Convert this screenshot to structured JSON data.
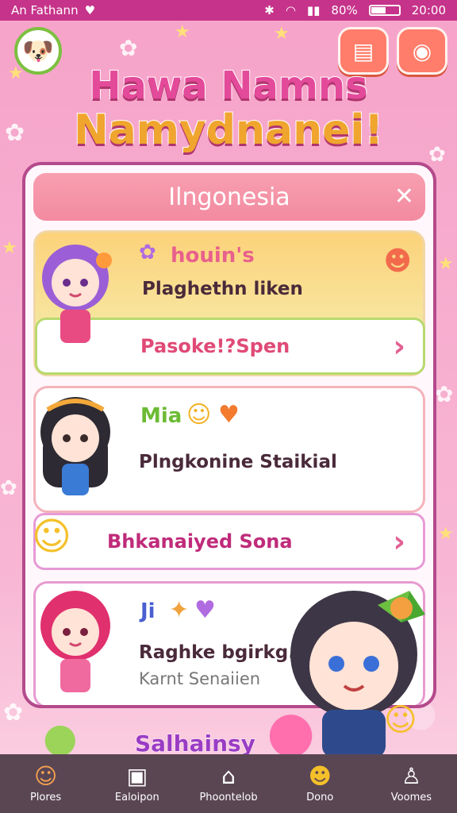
{
  "status_bar": {
    "left_text": "An Fathann",
    "heart_icon": "heart-icon",
    "battery_text": "80%",
    "time": "20:00"
  },
  "header": {
    "title_line1": "Hawa Namns",
    "title_line2": "Namydnanei!"
  },
  "panel": {
    "title": "Ilngonesia",
    "close_symbol": "✕"
  },
  "cards": [
    {
      "name": "houin's",
      "line": "Plaghethn liken",
      "sub_label": "Pasoke!?Spen"
    },
    {
      "name": "Mia",
      "line": "Plngkonine Staikial",
      "sub_label": "Bhkanaiyed Sona"
    },
    {
      "name": "Ji",
      "line": "Raghke bgirkg.",
      "line2": "Karnt Senaiien"
    }
  ],
  "bottom_label": "Salhainsy",
  "nav": [
    {
      "label": "Plores",
      "icon": "character-icon"
    },
    {
      "label": "Ealoipon",
      "icon": "gallery-icon"
    },
    {
      "label": "Phoontelob",
      "icon": "home-icon"
    },
    {
      "label": "Dono",
      "icon": "pet-icon"
    },
    {
      "label": "Voomes",
      "icon": "profile-icon"
    }
  ],
  "colors": {
    "status_bar": "#c6338a",
    "nav_bar": "#5a4653",
    "panel_border": "#b44a8c",
    "accent_orange": "#ff7d6a"
  }
}
